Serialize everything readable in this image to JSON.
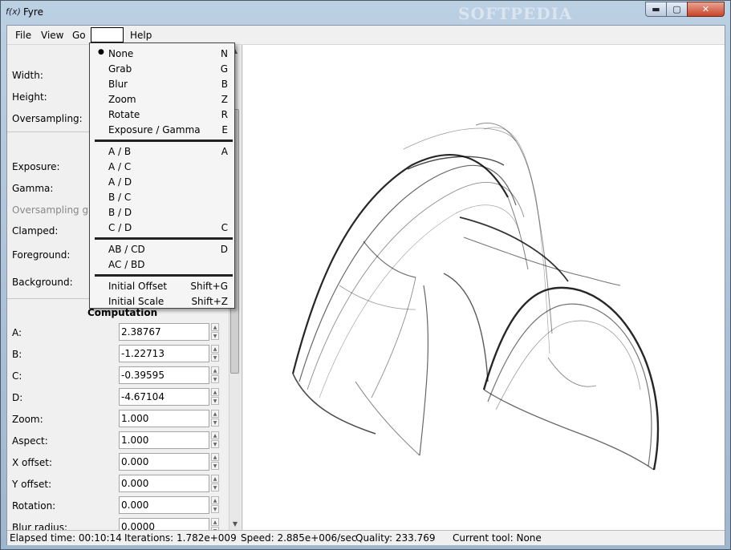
{
  "window": {
    "title": "Fyre",
    "app_icon": "f(x)",
    "watermark": "SOFTPEDIA",
    "caption": {
      "minimize": "▬",
      "maximize": "▢",
      "close": "✕"
    }
  },
  "menubar": {
    "file": "File",
    "view": "View",
    "go": "Go",
    "help": "Help"
  },
  "sidebar": {
    "fields": [
      {
        "label": "Width:"
      },
      {
        "label": "Height:"
      },
      {
        "label": "Oversampling:"
      },
      {
        "label": "Exposure:"
      },
      {
        "label": "Gamma:"
      },
      {
        "label": "Oversampling gam"
      },
      {
        "label": "Clamped:"
      },
      {
        "label": "Foreground:"
      },
      {
        "label": "Background:"
      }
    ],
    "computation_title": "Computation",
    "params": [
      {
        "label": "A:",
        "value": "2.38767"
      },
      {
        "label": "B:",
        "value": "-1.22713"
      },
      {
        "label": "C:",
        "value": "-0.39595"
      },
      {
        "label": "D:",
        "value": "-4.67104"
      },
      {
        "label": "Zoom:",
        "value": "1.000"
      },
      {
        "label": "Aspect:",
        "value": "1.000"
      },
      {
        "label": "X offset:",
        "value": "0.000"
      },
      {
        "label": "Y offset:",
        "value": "0.000"
      },
      {
        "label": "Rotation:",
        "value": "0.000"
      },
      {
        "label": "Blur radius:",
        "value": "0.0000"
      }
    ]
  },
  "dropdown": {
    "group1": [
      {
        "label": "None",
        "key": "N",
        "selected": true
      },
      {
        "label": "Grab",
        "key": "G"
      },
      {
        "label": "Blur",
        "key": "B"
      },
      {
        "label": "Zoom",
        "key": "Z"
      },
      {
        "label": "Rotate",
        "key": "R"
      },
      {
        "label": "Exposure / Gamma",
        "key": "E"
      }
    ],
    "group2": [
      {
        "label": "A / B",
        "key": "A"
      },
      {
        "label": "A / C",
        "key": ""
      },
      {
        "label": "A / D",
        "key": ""
      },
      {
        "label": "B / C",
        "key": ""
      },
      {
        "label": "B / D",
        "key": ""
      },
      {
        "label": "C / D",
        "key": "C"
      }
    ],
    "group3": [
      {
        "label": "AB / CD",
        "key": "D"
      },
      {
        "label": "AC / BD",
        "key": ""
      }
    ],
    "group4": [
      {
        "label": "Initial Offset",
        "key": "Shift+G"
      },
      {
        "label": "Initial Scale",
        "key": "Shift+Z"
      }
    ],
    "bullet": "●"
  },
  "status": {
    "elapsed": "Elapsed time: 00:10:14",
    "iterations": "Iterations: 1.782e+009",
    "speed": "Speed: 2.885e+006/sec",
    "quality": "Quality: 233.769",
    "tool": "Current tool: None"
  },
  "spin_arrows": {
    "up": "▲",
    "down": "▼"
  }
}
